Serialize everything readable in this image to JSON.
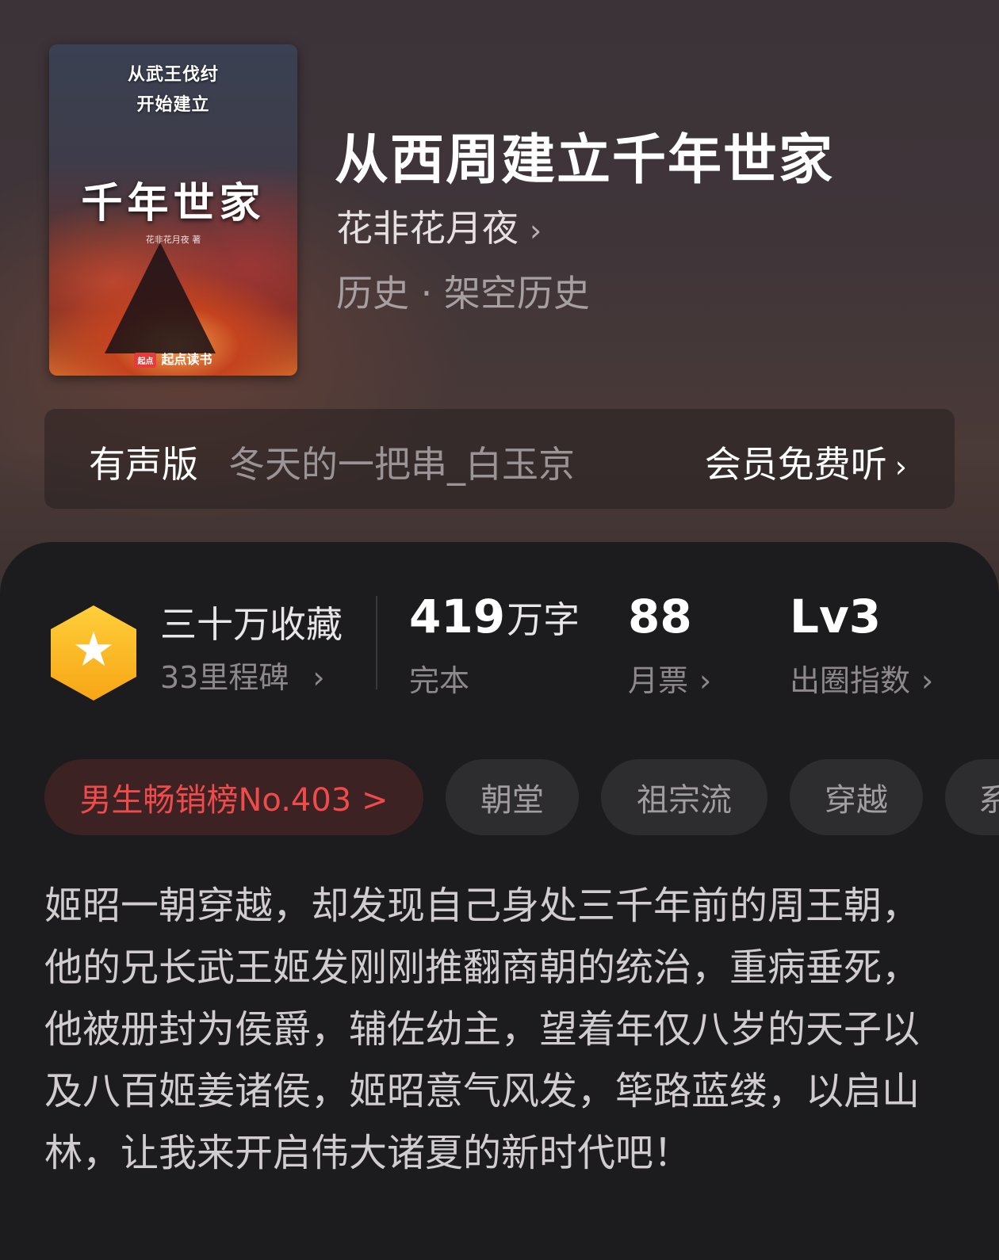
{
  "book": {
    "title": "从西周建立千年世家",
    "author": "花非花月夜",
    "author_chevron": "›",
    "genre": "历史 · 架空历史",
    "cover": {
      "subtitle_line1": "从武王伐纣",
      "subtitle_line2": "开始建立",
      "title": "千年世家",
      "author": "花非花月夜 著",
      "publisher_logo": "起点",
      "publisher": "起点读书"
    }
  },
  "audio": {
    "label": "有声版",
    "narrator": "冬天的一把串_白玉京",
    "cta": "会员免费听",
    "chevron": "›"
  },
  "stats": {
    "badge_icon": "star-icon",
    "collections": "三十万收藏",
    "milestones": "33里程碑",
    "word_count": "419",
    "word_unit": "万字",
    "status": "完本",
    "monthly_tickets": "88",
    "monthly_tickets_label": "月票",
    "level": "Lv3",
    "level_label": "出圈指数",
    "chevron": "›"
  },
  "tags": {
    "rank": "男生畅销榜No.403 >",
    "items": [
      "朝堂",
      "祖宗流",
      "穿越",
      "系"
    ]
  },
  "synopsis": "姬昭一朝穿越，却发现自己身处三千年前的周王朝，他的兄长武王姬发刚刚推翻商朝的统治，重病垂死，他被册封为侯爵，辅佐幼主，望着年仅八岁的天子以及八百姬姜诸侯，姬昭意气风发，筚路蓝缕，以启山林，让我来开启伟大诸夏的新时代吧！",
  "colors": {
    "accent_gold": "#f7a515",
    "rank_red": "#f04b4b",
    "panel_bg": "#1c1b1d"
  }
}
